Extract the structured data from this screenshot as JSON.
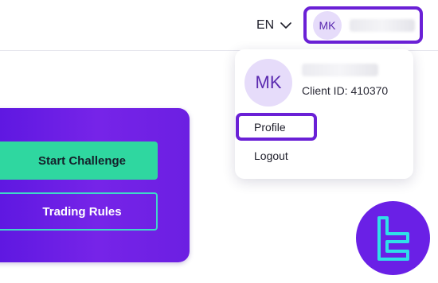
{
  "header": {
    "language": "EN",
    "user": {
      "initials": "MK"
    }
  },
  "user_menu": {
    "initials": "MK",
    "client_id_label": "Client ID: 410370",
    "items": [
      {
        "label": "Profile",
        "highlighted": true
      },
      {
        "label": "Logout",
        "highlighted": false
      }
    ]
  },
  "promo": {
    "start_button": "Start Challenge",
    "rules_button": "Trading Rules"
  },
  "colors": {
    "accent": "#6a20d6",
    "avatar_bg": "#e6dcfa",
    "promo_bg": "#6a1fe4",
    "start_button_bg": "#2fd7a0",
    "rules_button_border": "#3fd7c8",
    "logo_bg": "#6a20e6",
    "logo_mark": "#2fe0e8"
  },
  "icons": {
    "language_toggle": "chevron-down-icon",
    "corner_logo": "brand-logo-icon"
  }
}
